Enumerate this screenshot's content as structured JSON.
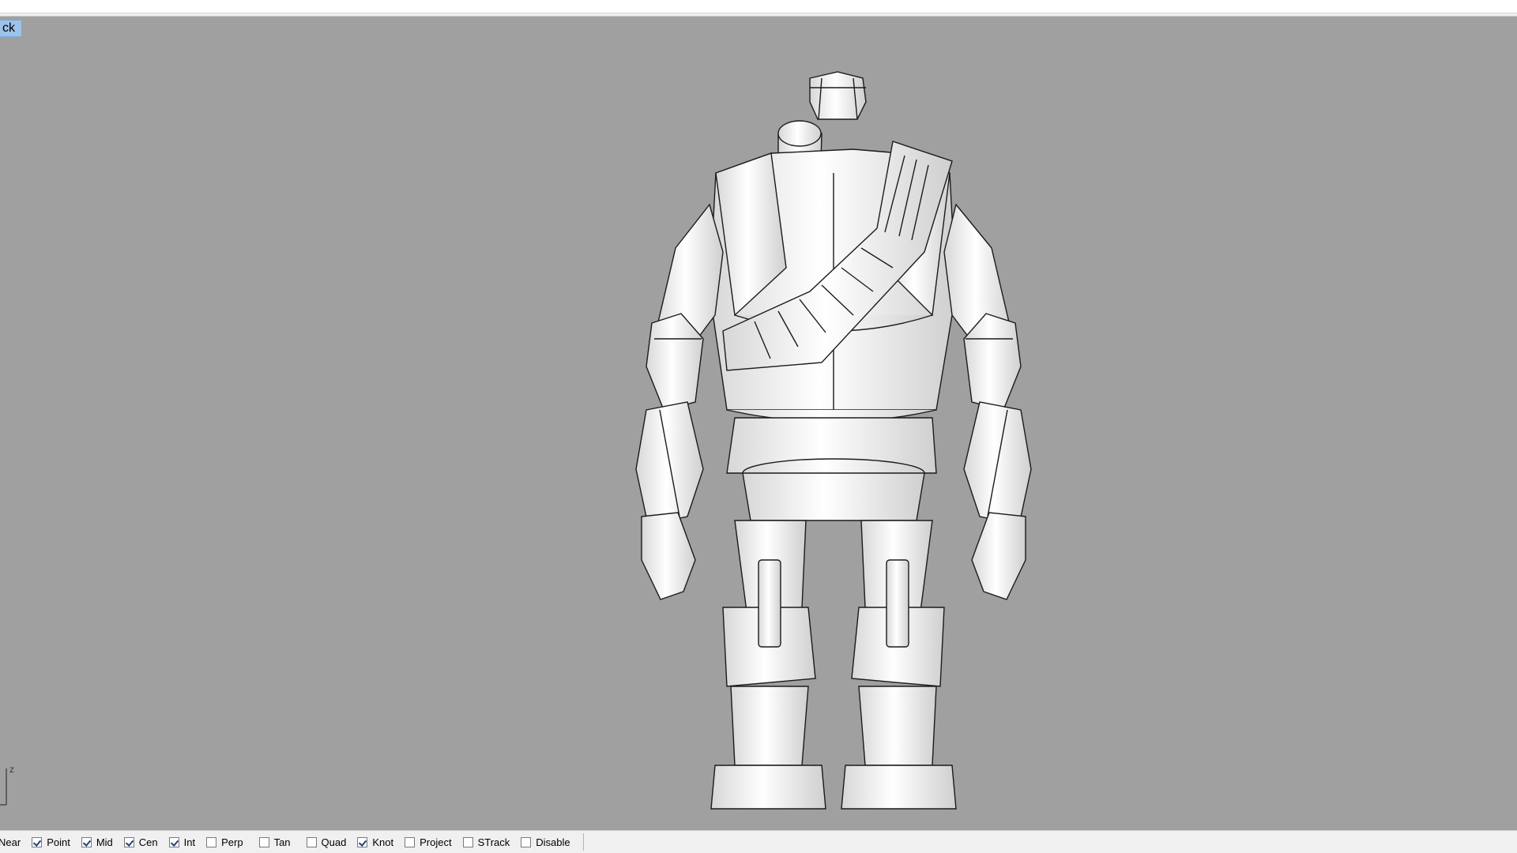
{
  "window": {
    "viewport_label": "ck"
  },
  "viewport": {
    "axis_label": "z"
  },
  "osnap": {
    "items": [
      {
        "label": "Near",
        "checked": false,
        "checkbox_visible": false
      },
      {
        "label": "Point",
        "checked": true,
        "checkbox_visible": true
      },
      {
        "label": "Mid",
        "checked": true,
        "checkbox_visible": true
      },
      {
        "label": "Cen",
        "checked": true,
        "checkbox_visible": true
      },
      {
        "label": "Int",
        "checked": true,
        "checkbox_visible": true
      },
      {
        "label": "Perp",
        "checked": false,
        "checkbox_visible": true
      },
      {
        "label": "Tan",
        "checked": false,
        "checkbox_visible": true
      },
      {
        "label": "Quad",
        "checked": false,
        "checkbox_visible": true
      },
      {
        "label": "Knot",
        "checked": true,
        "checkbox_visible": true
      },
      {
        "label": "Project",
        "checked": false,
        "checkbox_visible": true
      },
      {
        "label": "STrack",
        "checked": false,
        "checkbox_visible": true
      },
      {
        "label": "Disable",
        "checked": false,
        "checkbox_visible": true
      }
    ]
  },
  "colors": {
    "viewport_bg": "#a0a0a0",
    "model_fill": "#f4f4f4",
    "model_stroke": "#1b1b1b",
    "title_bg": "#9dc3ea"
  }
}
